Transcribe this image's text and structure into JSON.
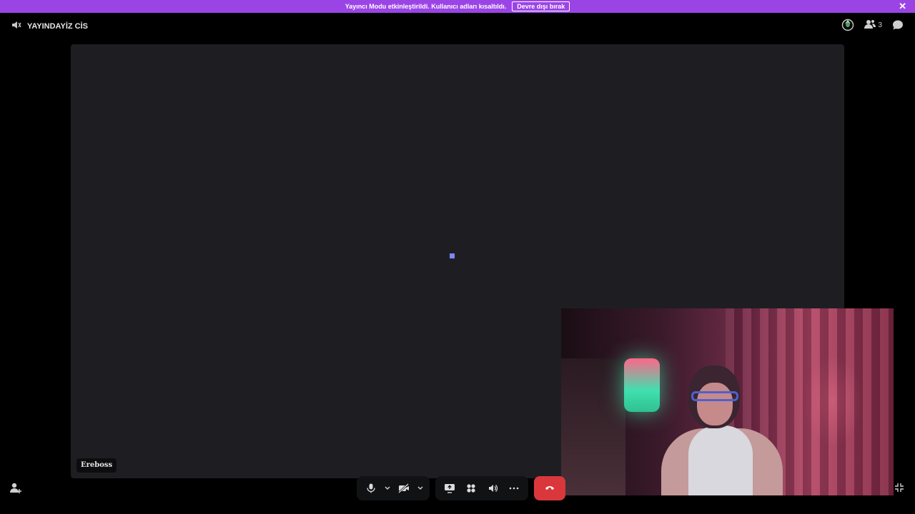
{
  "banner": {
    "text": "Yayıncı Modu etkinleştirildi. Kullanıcı adları kısaltıldı.",
    "disable_label": "Devre dışı bırak",
    "close_icon": "close-icon",
    "color": "#9b44e6"
  },
  "header": {
    "channel_icon": "voice-channel-icon",
    "channel_name": "YAYINDAYİZ CİS",
    "activity_icon": "activity-icon",
    "participants_icon": "people-icon",
    "participants_count": "3",
    "chat_icon": "chat-bubble-icon"
  },
  "stage": {
    "participant_name": "Ereboss",
    "loader_color": "#7f84ff"
  },
  "controls": {
    "mic_icon": "microphone-icon",
    "camera_icon": "camera-off-icon",
    "screenshare_icon": "screen-share-icon",
    "activities_icon": "activities-icon",
    "soundboard_icon": "soundboard-icon",
    "more_icon": "more-icon",
    "hangup_icon": "hangup-icon",
    "hangup_color": "#da373c"
  },
  "footer": {
    "invite_icon": "invite-user-icon",
    "minimize_icon": "minimize-icon"
  }
}
